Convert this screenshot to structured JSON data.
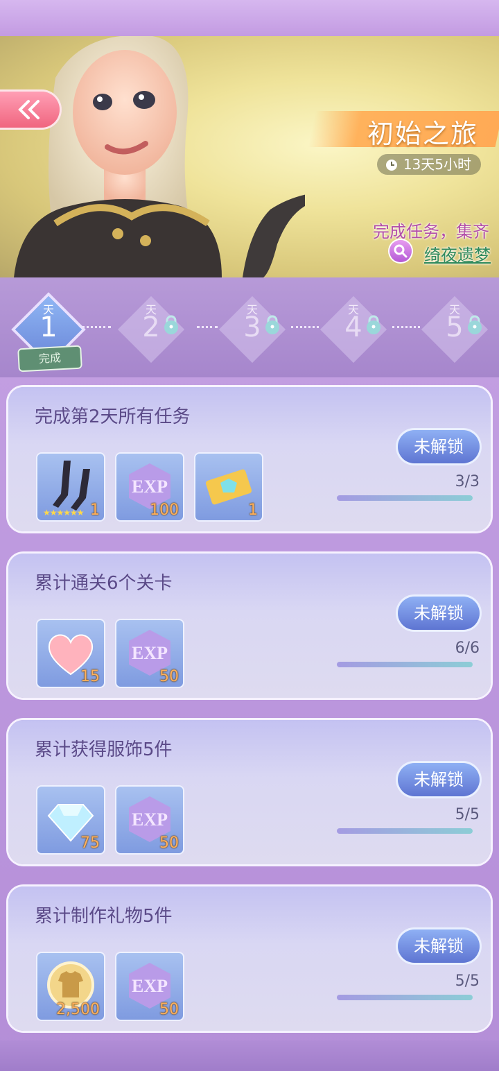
{
  "banner": {
    "title": "初始之旅",
    "timer": "13天5小时",
    "desc": "完成任务，集齐",
    "set_link": "绮夜遗梦"
  },
  "days": [
    {
      "label": "天",
      "num": "1",
      "active": true,
      "badge": "完成"
    },
    {
      "label": "天",
      "num": "2",
      "locked": true
    },
    {
      "label": "天",
      "num": "3",
      "locked": true
    },
    {
      "label": "天",
      "num": "4",
      "locked": true
    },
    {
      "label": "天",
      "num": "5",
      "locked": true
    }
  ],
  "tasks": [
    {
      "title": "完成第2天所有任务",
      "button": "未解锁",
      "progress": "3/3",
      "progress_fraction": 1.0,
      "rewards": [
        {
          "icon": "stockings-icon",
          "count": "1",
          "stars": "★★★★★★"
        },
        {
          "icon": "exp-icon",
          "count": "100"
        },
        {
          "icon": "diamond-ticket-icon",
          "count": "1"
        }
      ]
    },
    {
      "title": "累计通关6个关卡",
      "button": "未解锁",
      "progress": "6/6",
      "progress_fraction": 1.0,
      "rewards": [
        {
          "icon": "heart-icon",
          "count": "15"
        },
        {
          "icon": "exp-icon",
          "count": "50"
        }
      ]
    },
    {
      "title": "累计获得服饰5件",
      "button": "未解锁",
      "progress": "5/5",
      "progress_fraction": 1.0,
      "rewards": [
        {
          "icon": "diamond-icon",
          "count": "75"
        },
        {
          "icon": "exp-icon",
          "count": "50"
        }
      ]
    },
    {
      "title": "累计制作礼物5件",
      "button": "未解锁",
      "progress": "5/5",
      "progress_fraction": 1.0,
      "rewards": [
        {
          "icon": "gold-coin-shirt-icon",
          "count": "2,500"
        },
        {
          "icon": "exp-icon",
          "count": "50"
        }
      ]
    }
  ],
  "exp_text": "EXP",
  "colors": {
    "accent_pink": "#f0657f",
    "button_blue": "#5e75d2",
    "count_orange": "#ffb05c"
  }
}
